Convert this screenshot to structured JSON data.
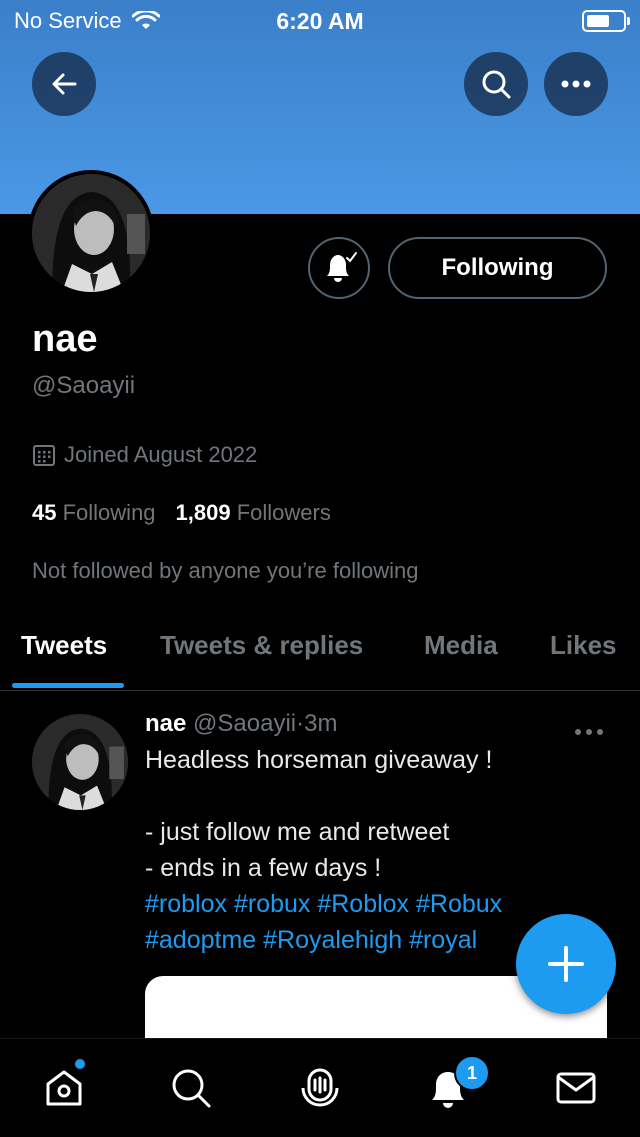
{
  "status_bar": {
    "carrier": "No Service",
    "time": "6:20 AM"
  },
  "profile": {
    "name": "nae",
    "handle": "@Saoayii",
    "joined": "Joined August 2022",
    "following_count": "45",
    "following_label": "Following",
    "followers_count": "1,809",
    "followers_label": "Followers",
    "not_followed": "Not followed by anyone you’re following",
    "follow_button_label": "Following"
  },
  "tabs": [
    {
      "label": "Tweets",
      "active": true
    },
    {
      "label": "Tweets & replies",
      "active": false
    },
    {
      "label": "Media",
      "active": false
    },
    {
      "label": "Likes",
      "active": false
    }
  ],
  "tweet": {
    "name": "nae",
    "handle": "@Saoayii",
    "separator": "·",
    "time": "3m",
    "text": "Headless horseman giveaway !\n\n- just follow me and retweet\n- ends in a few days !",
    "hashtags_line1": "#roblox #robux #Roblox #Robux",
    "hashtags_line2": "#adoptme #Royalehigh #royal"
  },
  "notifications_badge": "1",
  "icons": {
    "back": "arrow-left-icon",
    "search": "search-icon",
    "more": "more-icon",
    "bell": "bell-check-icon",
    "calendar": "calendar-icon",
    "compose": "plus-icon",
    "home": "home-icon",
    "explore": "search-icon",
    "spaces": "microphone-icon",
    "notifications": "bell-icon",
    "messages": "mail-icon"
  },
  "colors": {
    "accent": "#1d9bf0",
    "banner": "#4a98e6",
    "muted": "#71767b"
  }
}
